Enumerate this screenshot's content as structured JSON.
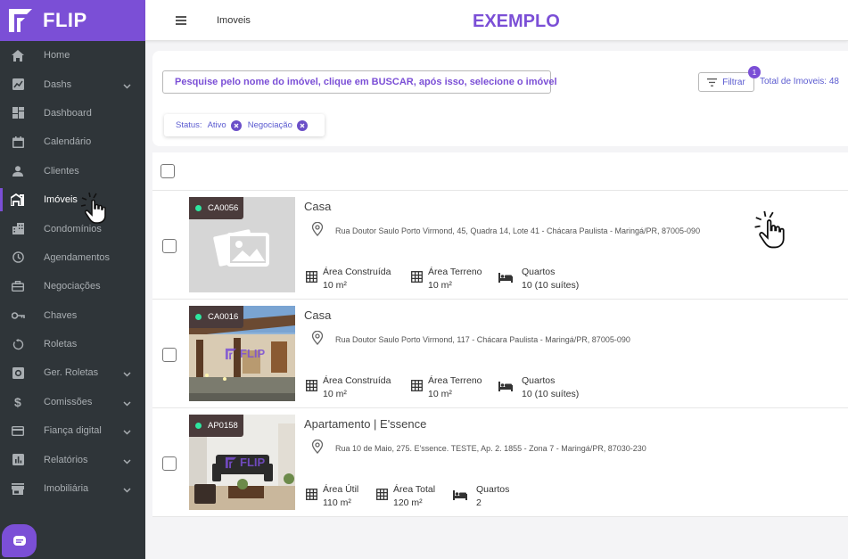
{
  "app": {
    "logo_text": "FLIP",
    "brand_color": "#7b4fd6"
  },
  "sidebar": {
    "items": [
      {
        "label": "Home",
        "icon": "home-icon",
        "has_chevron": false
      },
      {
        "label": "Dashs",
        "icon": "chart-icon",
        "has_chevron": true
      },
      {
        "label": "Dashboard",
        "icon": "dashboard-icon",
        "has_chevron": false
      },
      {
        "label": "Calendário",
        "icon": "calendar-icon",
        "has_chevron": false
      },
      {
        "label": "Clientes",
        "icon": "person-icon",
        "has_chevron": false
      },
      {
        "label": "Imóveis",
        "icon": "house-icon",
        "has_chevron": false,
        "active": true
      },
      {
        "label": "Condomínios",
        "icon": "building-icon",
        "has_chevron": false
      },
      {
        "label": "Agendamentos",
        "icon": "clock-icon",
        "has_chevron": false
      },
      {
        "label": "Negociações",
        "icon": "briefcase-icon",
        "has_chevron": false
      },
      {
        "label": "Chaves",
        "icon": "key-icon",
        "has_chevron": false
      },
      {
        "label": "Roletas",
        "icon": "rotate-icon",
        "has_chevron": false
      },
      {
        "label": "Ger. Roletas",
        "icon": "settings-box-icon",
        "has_chevron": true
      },
      {
        "label": "Comissões",
        "icon": "dollar-icon",
        "has_chevron": true
      },
      {
        "label": "Fiança digital",
        "icon": "card-icon",
        "has_chevron": true
      },
      {
        "label": "Relatórios",
        "icon": "report-icon",
        "has_chevron": true
      },
      {
        "label": "Imobiliária",
        "icon": "store-icon",
        "has_chevron": true
      }
    ]
  },
  "topbar": {
    "page_name": "Imoveis",
    "banner": "EXEMPLO"
  },
  "search": {
    "placeholder": "Pesquise pelo nome do imóvel, clique em BUSCAR, após isso, selecione o imóvel",
    "filter_label": "Filtrar",
    "filter_count": "1",
    "total_label": "Total de Imoveis: 48"
  },
  "filters": {
    "status_label": "Status:",
    "chips": [
      "Ativo",
      "Negociação"
    ]
  },
  "properties": [
    {
      "code": "CA0056",
      "title": "Casa",
      "address": "Rua Doutor Saulo Porto Virmond, 45, Quadra 14, Lote 41 - Chácara Paulista - Maringá/PR, 87005-090",
      "image": "placeholder",
      "features": [
        {
          "label": "Área Construída",
          "value": "10 m²",
          "icon": "area-grid-icon"
        },
        {
          "label": "Área Terreno",
          "value": "10 m²",
          "icon": "area-grid-icon"
        },
        {
          "label": "Quartos",
          "value": "10 (10 suítes)",
          "icon": "bed-icon"
        }
      ]
    },
    {
      "code": "CA0016",
      "title": "Casa",
      "address": "Rua Doutor Saulo Porto Virmond, 117 - Chácara Paulista - Maringá/PR, 87005-090",
      "image": "house-photo",
      "watermark": "FLIP",
      "features": [
        {
          "label": "Área Construída",
          "value": "10 m²",
          "icon": "area-grid-icon"
        },
        {
          "label": "Área Terreno",
          "value": "10 m²",
          "icon": "area-grid-icon"
        },
        {
          "label": "Quartos",
          "value": "10 (10 suítes)",
          "icon": "bed-icon"
        }
      ]
    },
    {
      "code": "AP0158",
      "title": "Apartamento | E'ssence",
      "address": "Rua 10 de Maio, 275. E'ssence. TESTE, Ap. 2. 1855 - Zona 7 - Maringá/PR, 87030-230",
      "image": "living-room-photo",
      "watermark": "FLIP",
      "features": [
        {
          "label": "Área Útil",
          "value": "110 m²",
          "icon": "area-grid-icon"
        },
        {
          "label": "Área Total",
          "value": "120 m²",
          "icon": "area-grid-icon"
        },
        {
          "label": "Quartos",
          "value": "2",
          "icon": "bed-icon"
        }
      ]
    }
  ]
}
